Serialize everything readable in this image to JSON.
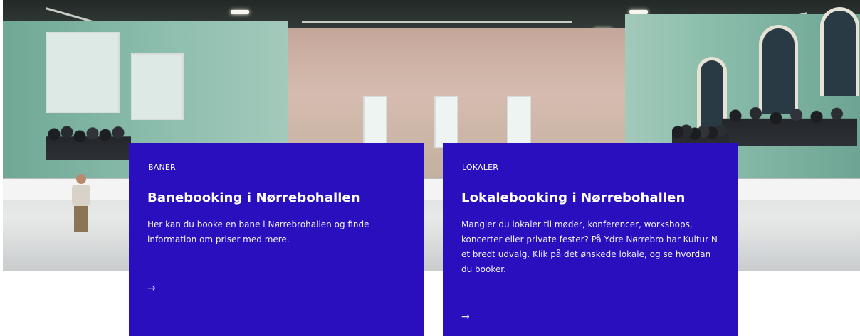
{
  "hero": {
    "image_description": "Indoor sports hall with spectators on a balcony"
  },
  "cards": [
    {
      "category": "BANER",
      "title": "Banebooking i Nørrebohallen",
      "description": "Her kan du booke en bane i Nørrebrohallen og finde information om priser med mere.",
      "arrow": "→"
    },
    {
      "category": "LOKALER",
      "title": "Lokalebooking i Nørrebohallen",
      "description": "Mangler du lokaler til møder, konferencer, workshops, koncerter eller private fester? På Ydre Nørrebro har Kultur N et bredt udvalg. Klik på det ønskede lokale, og se hvordan du booker.",
      "arrow": "→"
    }
  ],
  "colors": {
    "card_background": "#2a0fbe",
    "card_text": "#ffffff",
    "page_background": "#ffffff"
  }
}
